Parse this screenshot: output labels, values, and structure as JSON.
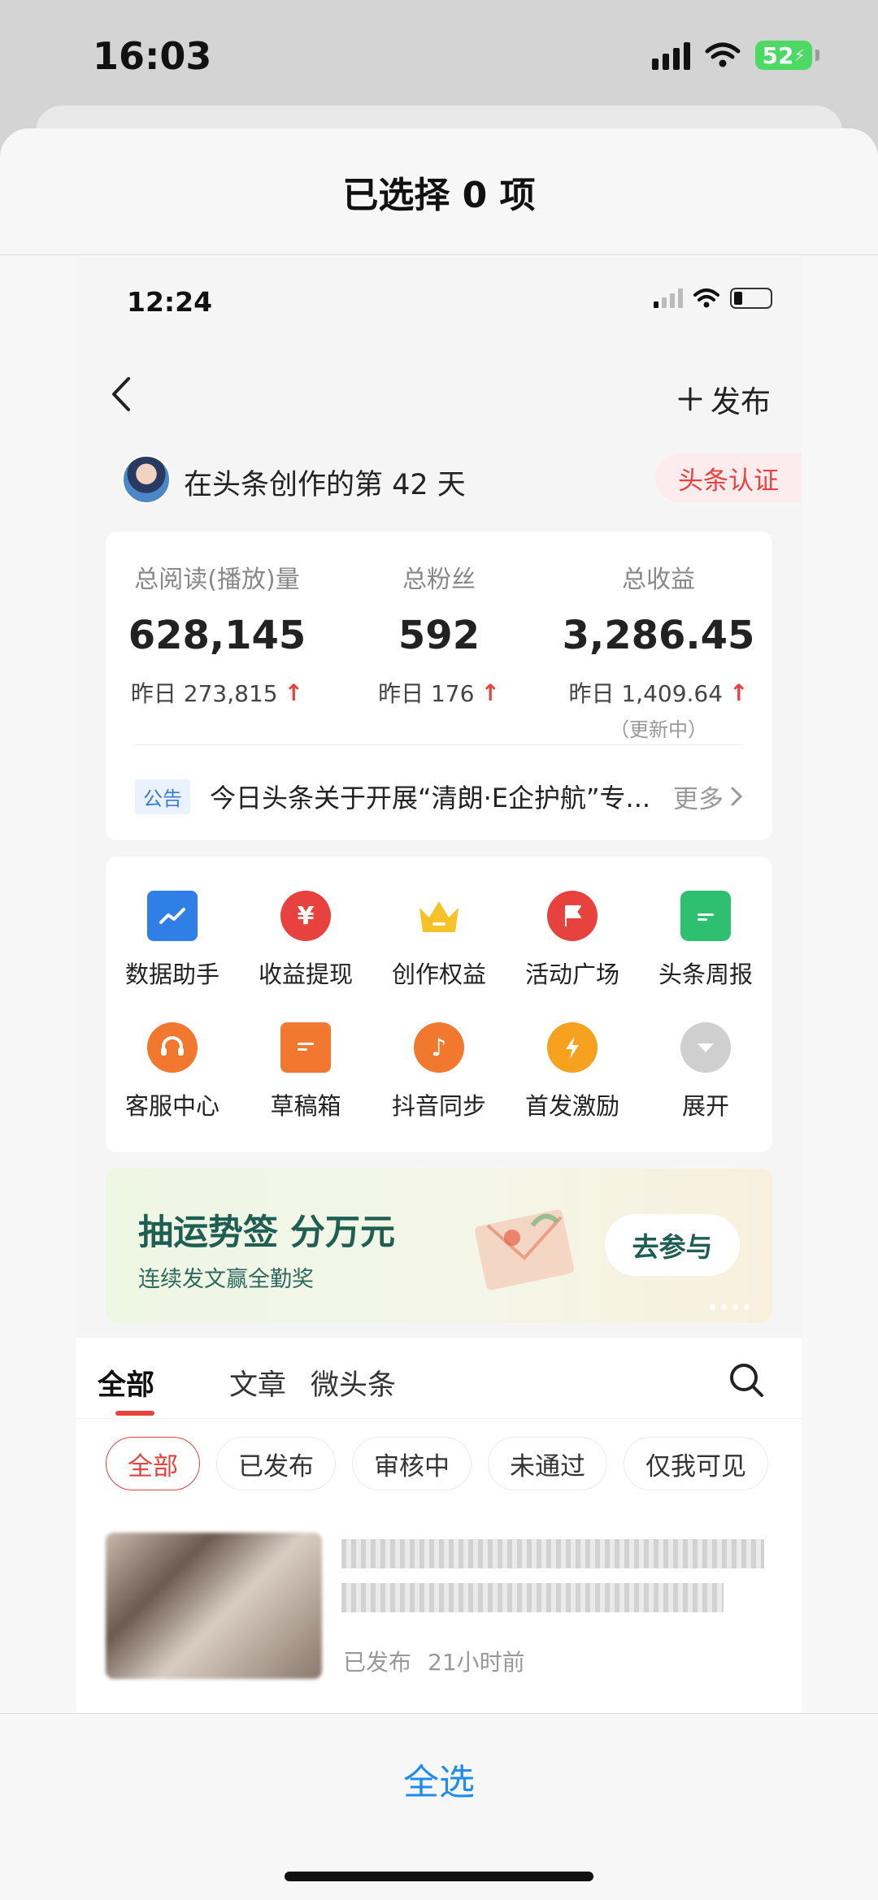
{
  "status_bar": {
    "time": "16:03",
    "battery": "52"
  },
  "sheet": {
    "title": "已选择 0 项",
    "select_all": "全选"
  },
  "inner": {
    "time": "12:24",
    "nav": {
      "publish": "发布"
    },
    "user": {
      "days_text": "在头条创作的第 42 天",
      "verify": "头条认证"
    },
    "stats": [
      {
        "label": "总阅读(播放)量",
        "value": "628,145",
        "yesterday": "昨日 273,815",
        "note": ""
      },
      {
        "label": "总粉丝",
        "value": "592",
        "yesterday": "昨日 176",
        "note": ""
      },
      {
        "label": "总收益",
        "value": "3,286.45",
        "yesterday": "昨日 1,409.64",
        "note": "（更新中）"
      }
    ],
    "notice": {
      "tag": "公告",
      "text": "今日头条关于开展“清朗·E企护航”专...",
      "more": "更多"
    },
    "tools": [
      {
        "label": "数据助手",
        "icon": "chart-icon",
        "color": "#2f7fe6"
      },
      {
        "label": "收益提现",
        "icon": "yuan-icon",
        "color": "#e8423f"
      },
      {
        "label": "创作权益",
        "icon": "crown-icon",
        "color": "#f6c22a"
      },
      {
        "label": "活动广场",
        "icon": "flag-icon",
        "color": "#e8423f"
      },
      {
        "label": "头条周报",
        "icon": "calendar-icon",
        "color": "#2fbf71"
      },
      {
        "label": "客服中心",
        "icon": "headset-icon",
        "color": "#f3782f"
      },
      {
        "label": "草稿箱",
        "icon": "draft-icon",
        "color": "#f3782f"
      },
      {
        "label": "抖音同步",
        "icon": "tiktok-icon",
        "color": "#f3782f"
      },
      {
        "label": "首发激励",
        "icon": "lightning-icon",
        "color": "#f6a21f"
      },
      {
        "label": "展开",
        "icon": "chevron-down-icon",
        "color": "#cfcfcf"
      }
    ],
    "banner": {
      "title": "抽运势签 分万元",
      "subtitle": "连续发文赢全勤奖",
      "button": "去参与"
    },
    "tabs": [
      "全部",
      "文章",
      "微头条"
    ],
    "filters": [
      "全部",
      "已发布",
      "审核中",
      "未通过",
      "仅我可见"
    ],
    "article": {
      "status": "已发布",
      "time": "21小时前"
    }
  }
}
